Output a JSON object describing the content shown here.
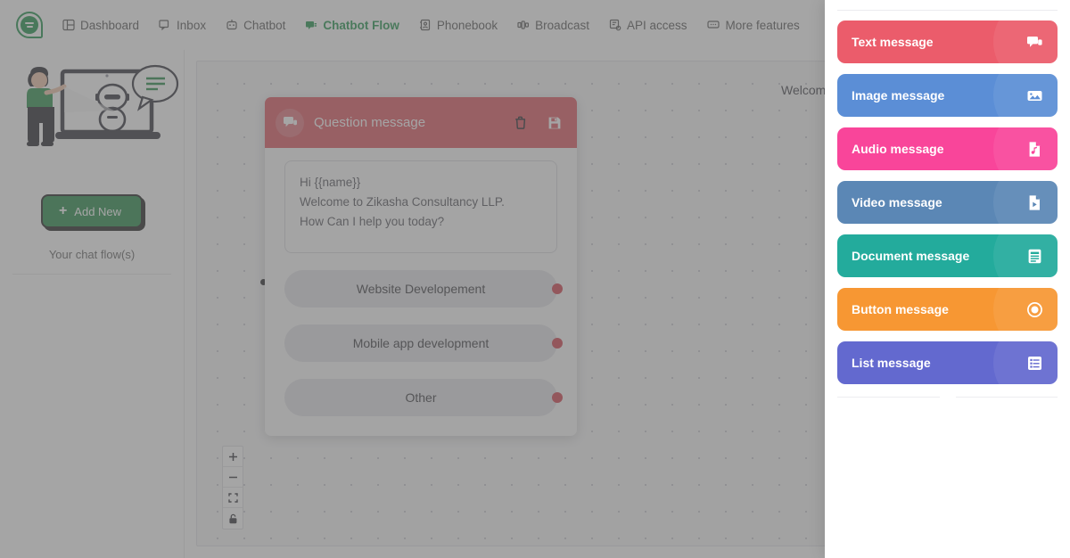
{
  "nav": {
    "logo_name": "zikasha-chat-logo",
    "items": [
      {
        "label": "Dashboard",
        "icon": "dashboard-icon",
        "active": false
      },
      {
        "label": "Inbox",
        "icon": "inbox-icon",
        "active": false
      },
      {
        "label": "Chatbot",
        "icon": "robot-icon",
        "active": false
      },
      {
        "label": "Chatbot Flow",
        "icon": "flow-icon",
        "active": true
      },
      {
        "label": "Phonebook",
        "icon": "contacts-icon",
        "active": false
      },
      {
        "label": "Broadcast",
        "icon": "broadcast-icon",
        "active": false
      },
      {
        "label": "API access",
        "icon": "api-icon",
        "active": false
      },
      {
        "label": "More features",
        "icon": "more-features-icon",
        "active": false
      }
    ]
  },
  "sidebar": {
    "illustration_name": "person-with-chatbot-illustration",
    "add_new_label": "Add New",
    "add_new_icon": "plus-icon",
    "flows_label": "Your chat flow(s)"
  },
  "canvas": {
    "welcome_text": "Welcome",
    "controls": [
      {
        "name": "zoom-in-control",
        "icon": "plus-icon"
      },
      {
        "name": "zoom-out-control",
        "icon": "minus-icon"
      },
      {
        "name": "fit-view-control",
        "icon": "fit-screen-icon"
      },
      {
        "name": "lock-control",
        "icon": "lock-icon"
      }
    ]
  },
  "node": {
    "title": "Question message",
    "header_icon": "chat-bubble-icon",
    "delete_icon": "trash-icon",
    "save_icon": "save-icon",
    "header_color": "#dc4a56",
    "message_text": "Hi {{name}}\nWelcome to Zikasha Consultancy LLP.\nHow Can I help you today?",
    "message_lines": [
      "Hi {{name}}",
      "Welcome to Zikasha Consultancy LLP.",
      "How Can I help you today?"
    ],
    "options": [
      {
        "label": "Website Developement"
      },
      {
        "label": "Mobile app development"
      },
      {
        "label": "Other"
      }
    ],
    "option_dot_color": "#cf3340"
  },
  "message_panel": {
    "items": [
      {
        "label": "Text message",
        "color": "#eb5c6b",
        "icon": "chat-bubble-icon"
      },
      {
        "label": "Image message",
        "color": "#5b8ed6",
        "icon": "image-icon"
      },
      {
        "label": "Audio message",
        "color": "#f9459a",
        "icon": "audio-file-icon"
      },
      {
        "label": "Video message",
        "color": "#5b87b5",
        "icon": "video-file-icon"
      },
      {
        "label": "Document message",
        "color": "#23ab9c",
        "icon": "document-icon"
      },
      {
        "label": "Button message",
        "color": "#f79733",
        "icon": "radio-button-icon"
      },
      {
        "label": "List message",
        "color": "#6369cf",
        "icon": "list-icon"
      }
    ]
  }
}
